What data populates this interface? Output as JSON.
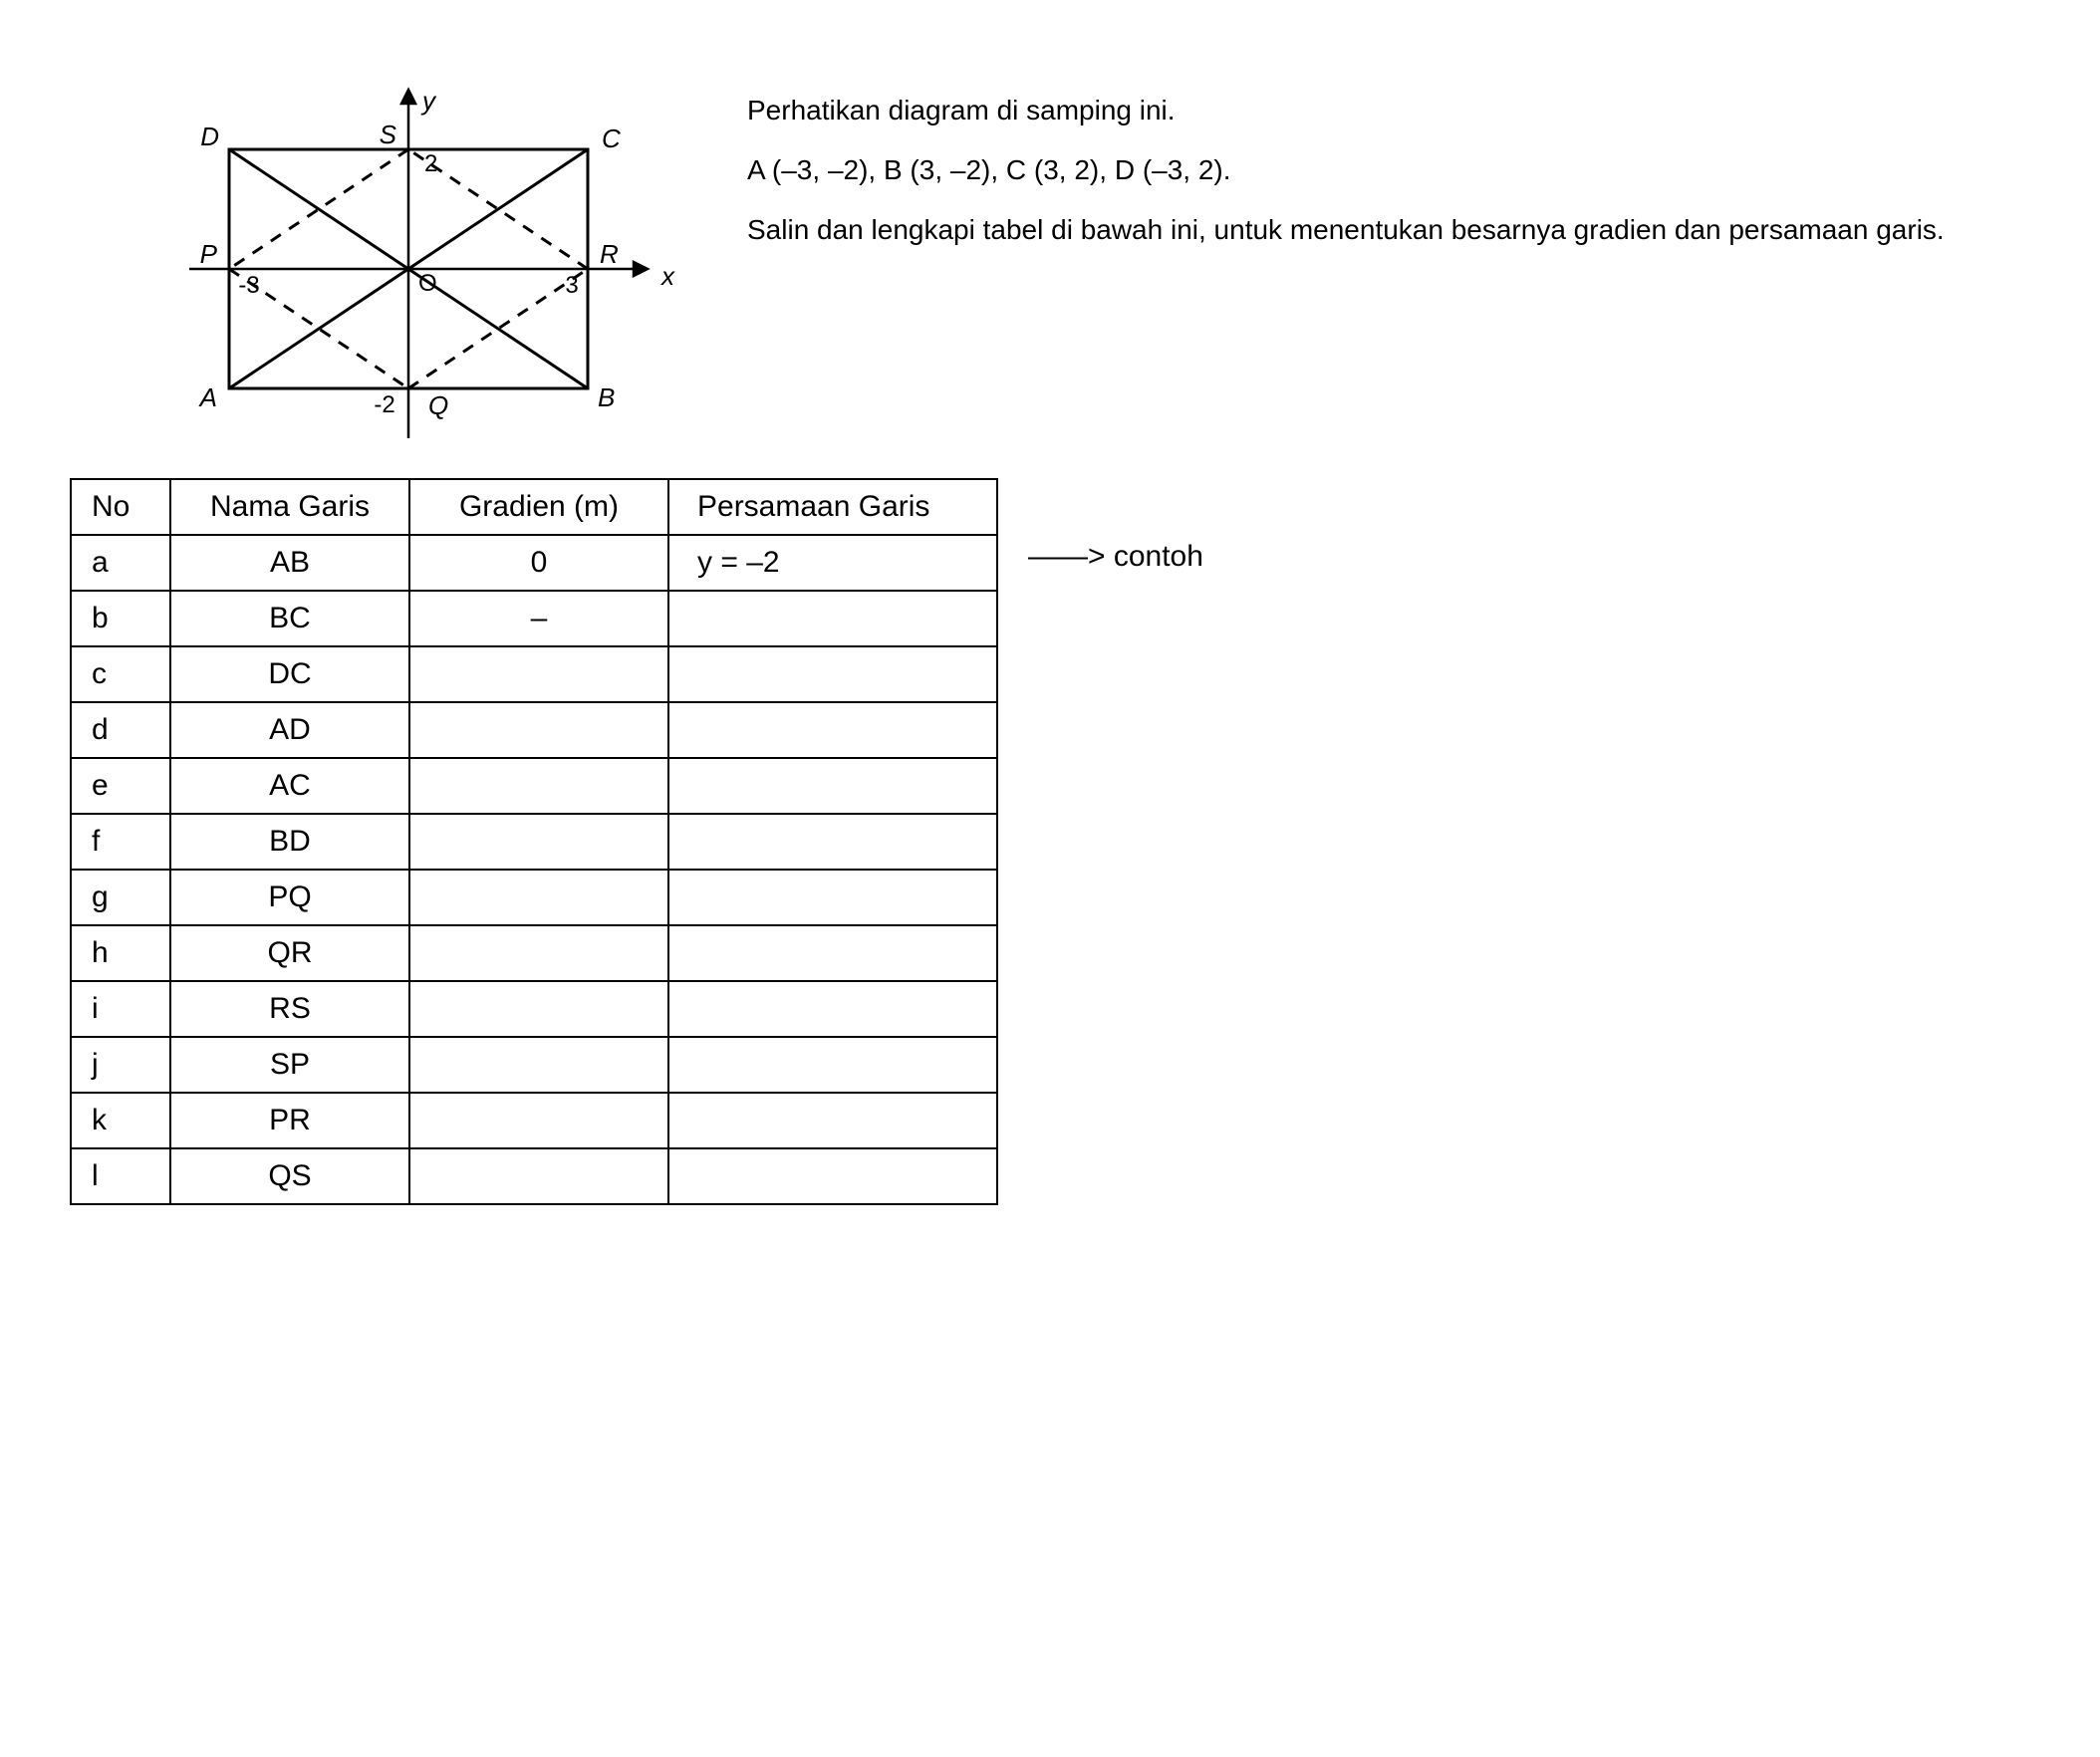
{
  "diagram": {
    "axis_y_label": "y",
    "axis_x_label": "x",
    "points": {
      "A": {
        "x": -3,
        "y": -2
      },
      "B": {
        "x": 3,
        "y": -2
      },
      "C": {
        "x": 3,
        "y": 2
      },
      "D": {
        "x": -3,
        "y": 2
      },
      "P": {
        "x": -3,
        "y": 0
      },
      "Q": {
        "x": 0,
        "y": -2
      },
      "R": {
        "x": 3,
        "y": 0
      },
      "S": {
        "x": 0,
        "y": 2
      }
    },
    "tick_labels": {
      "x_neg": "-3",
      "x_pos": "3",
      "y_pos": "2",
      "y_neg": "-2"
    },
    "origin_label": "O"
  },
  "instructions": {
    "line1": "Perhatikan diagram di samping ini.",
    "line2": "A (–3, –2), B (3, –2), C (3, 2), D (–3, 2).",
    "line3": "Salin dan lengkapi tabel di bawah ini, untuk menentukan besarnya gradien dan persamaan garis."
  },
  "table": {
    "headers": {
      "no": "No",
      "name": "Nama Garis",
      "gradient": "Gradien (m)",
      "equation": "Persamaan Garis"
    },
    "rows": [
      {
        "no": "a",
        "name": "AB",
        "gradient": "0",
        "equation": "y = –2"
      },
      {
        "no": "b",
        "name": "BC",
        "gradient": "–",
        "equation": ""
      },
      {
        "no": "c",
        "name": "DC",
        "gradient": "",
        "equation": ""
      },
      {
        "no": "d",
        "name": "AD",
        "gradient": "",
        "equation": ""
      },
      {
        "no": "e",
        "name": "AC",
        "gradient": "",
        "equation": ""
      },
      {
        "no": "f",
        "name": "BD",
        "gradient": "",
        "equation": ""
      },
      {
        "no": "g",
        "name": "PQ",
        "gradient": "",
        "equation": ""
      },
      {
        "no": "h",
        "name": "QR",
        "gradient": "",
        "equation": ""
      },
      {
        "no": "i",
        "name": "RS",
        "gradient": "",
        "equation": ""
      },
      {
        "no": "j",
        "name": "SP",
        "gradient": "",
        "equation": ""
      },
      {
        "no": "k",
        "name": "PR",
        "gradient": "",
        "equation": ""
      },
      {
        "no": "l",
        "name": "QS",
        "gradient": "",
        "equation": ""
      }
    ]
  },
  "contoh_note": "——>  contoh"
}
